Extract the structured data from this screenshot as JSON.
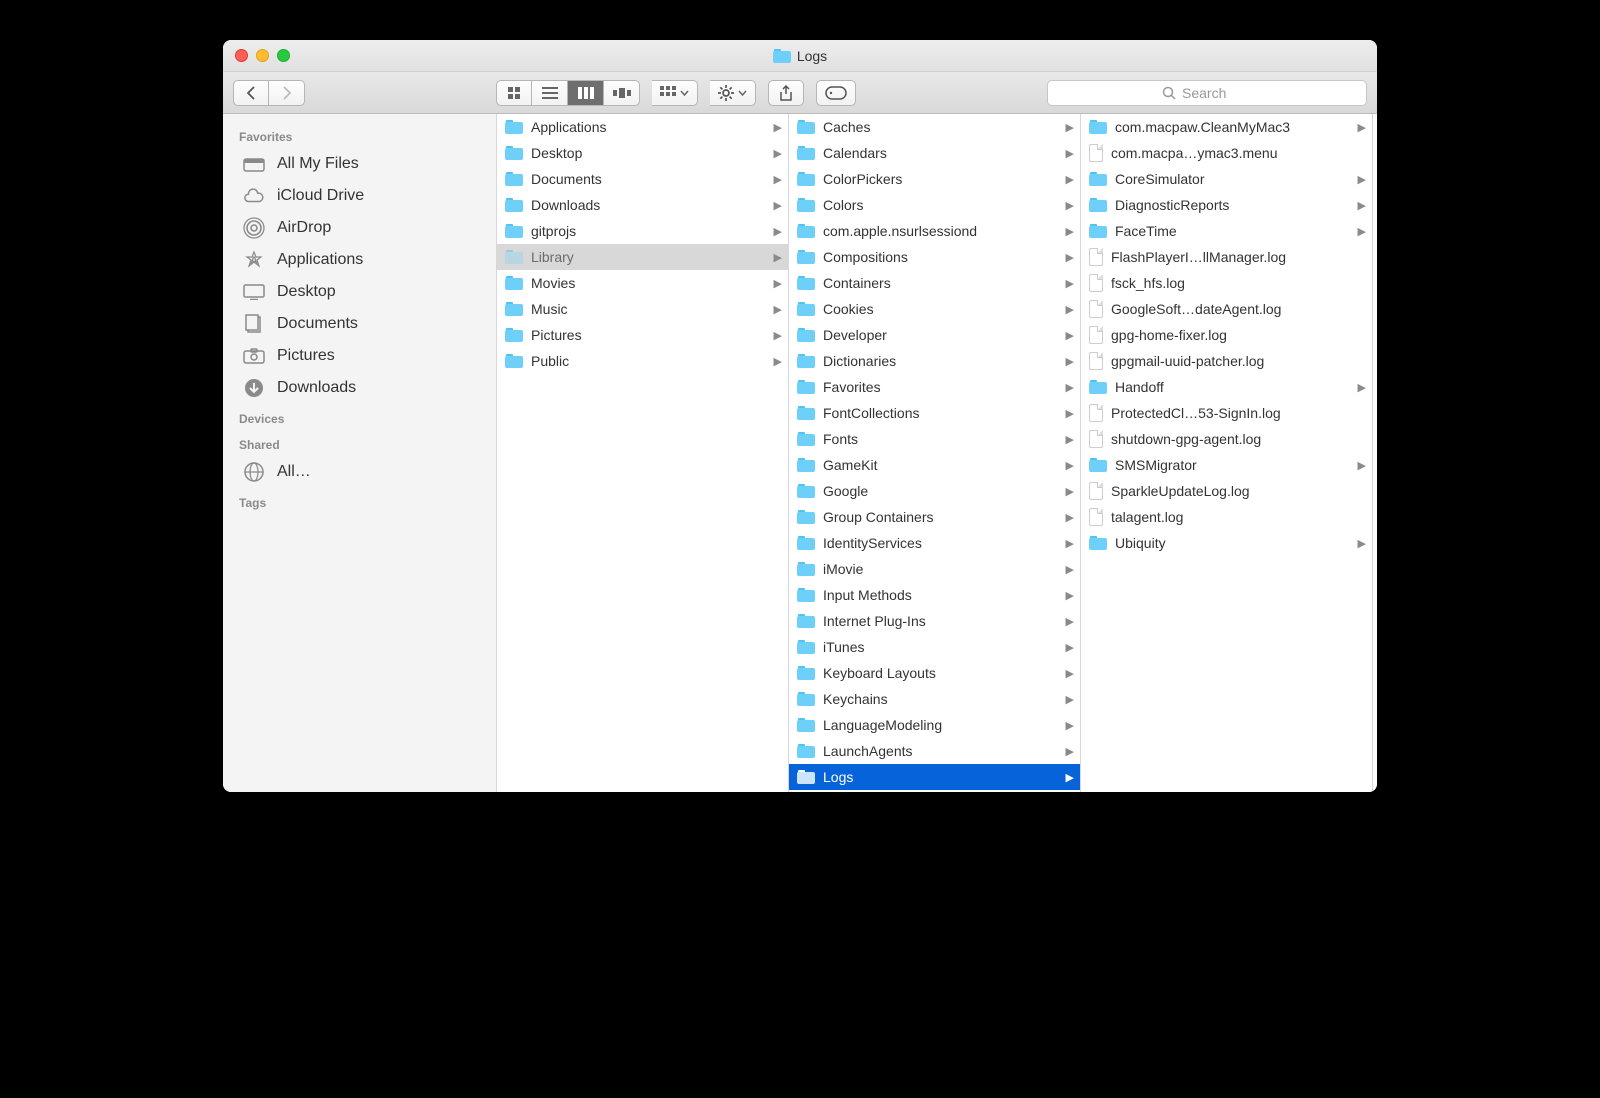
{
  "window": {
    "title": "Logs"
  },
  "toolbar": {
    "search_placeholder": "Search"
  },
  "sidebar": {
    "sections": [
      {
        "heading": "Favorites",
        "items": [
          {
            "icon": "all-my-files",
            "label": "All My Files"
          },
          {
            "icon": "icloud",
            "label": "iCloud Drive"
          },
          {
            "icon": "airdrop",
            "label": "AirDrop"
          },
          {
            "icon": "applications",
            "label": "Applications"
          },
          {
            "icon": "desktop",
            "label": "Desktop"
          },
          {
            "icon": "documents",
            "label": "Documents"
          },
          {
            "icon": "pictures",
            "label": "Pictures"
          },
          {
            "icon": "downloads",
            "label": "Downloads"
          }
        ]
      },
      {
        "heading": "Devices",
        "items": []
      },
      {
        "heading": "Shared",
        "items": [
          {
            "icon": "network",
            "label": "All…"
          }
        ]
      },
      {
        "heading": "Tags",
        "items": []
      }
    ]
  },
  "columns": [
    {
      "items": [
        {
          "type": "folder",
          "label": "Applications",
          "hasChildren": true
        },
        {
          "type": "folder",
          "label": "Desktop",
          "hasChildren": true
        },
        {
          "type": "folder",
          "label": "Documents",
          "hasChildren": true
        },
        {
          "type": "folder",
          "label": "Downloads",
          "hasChildren": true
        },
        {
          "type": "folder",
          "label": "gitprojs",
          "hasChildren": true
        },
        {
          "type": "folder",
          "label": "Library",
          "hasChildren": true,
          "selected": "grey"
        },
        {
          "type": "folder",
          "label": "Movies",
          "hasChildren": true
        },
        {
          "type": "folder",
          "label": "Music",
          "hasChildren": true
        },
        {
          "type": "folder",
          "label": "Pictures",
          "hasChildren": true
        },
        {
          "type": "folder",
          "label": "Public",
          "hasChildren": true
        }
      ]
    },
    {
      "items": [
        {
          "type": "folder",
          "label": "Caches",
          "hasChildren": true
        },
        {
          "type": "folder",
          "label": "Calendars",
          "hasChildren": true
        },
        {
          "type": "folder",
          "label": "ColorPickers",
          "hasChildren": true
        },
        {
          "type": "folder",
          "label": "Colors",
          "hasChildren": true
        },
        {
          "type": "folder",
          "label": "com.apple.nsurlsessiond",
          "hasChildren": true
        },
        {
          "type": "folder",
          "label": "Compositions",
          "hasChildren": true
        },
        {
          "type": "folder",
          "label": "Containers",
          "hasChildren": true
        },
        {
          "type": "folder",
          "label": "Cookies",
          "hasChildren": true
        },
        {
          "type": "folder",
          "label": "Developer",
          "hasChildren": true
        },
        {
          "type": "folder",
          "label": "Dictionaries",
          "hasChildren": true
        },
        {
          "type": "folder",
          "label": "Favorites",
          "hasChildren": true
        },
        {
          "type": "folder",
          "label": "FontCollections",
          "hasChildren": true
        },
        {
          "type": "folder",
          "label": "Fonts",
          "hasChildren": true
        },
        {
          "type": "folder",
          "label": "GameKit",
          "hasChildren": true
        },
        {
          "type": "folder",
          "label": "Google",
          "hasChildren": true
        },
        {
          "type": "folder",
          "label": "Group Containers",
          "hasChildren": true
        },
        {
          "type": "folder",
          "label": "IdentityServices",
          "hasChildren": true
        },
        {
          "type": "folder",
          "label": "iMovie",
          "hasChildren": true
        },
        {
          "type": "folder",
          "label": "Input Methods",
          "hasChildren": true
        },
        {
          "type": "folder",
          "label": "Internet Plug-Ins",
          "hasChildren": true
        },
        {
          "type": "folder",
          "label": "iTunes",
          "hasChildren": true
        },
        {
          "type": "folder",
          "label": "Keyboard Layouts",
          "hasChildren": true
        },
        {
          "type": "folder",
          "label": "Keychains",
          "hasChildren": true
        },
        {
          "type": "folder",
          "label": "LanguageModeling",
          "hasChildren": true
        },
        {
          "type": "folder",
          "label": "LaunchAgents",
          "hasChildren": true
        },
        {
          "type": "folder",
          "label": "Logs",
          "hasChildren": true,
          "selected": "blue"
        }
      ]
    },
    {
      "items": [
        {
          "type": "folder",
          "label": "com.macpaw.CleanMyMac3",
          "hasChildren": true
        },
        {
          "type": "file",
          "label": "com.macpa…ymac3.menu"
        },
        {
          "type": "folder",
          "label": "CoreSimulator",
          "hasChildren": true
        },
        {
          "type": "folder",
          "label": "DiagnosticReports",
          "hasChildren": true
        },
        {
          "type": "folder",
          "label": "FaceTime",
          "hasChildren": true
        },
        {
          "type": "file",
          "label": "FlashPlayerI…llManager.log"
        },
        {
          "type": "file",
          "label": "fsck_hfs.log"
        },
        {
          "type": "file",
          "label": "GoogleSoft…dateAgent.log"
        },
        {
          "type": "file",
          "label": "gpg-home-fixer.log"
        },
        {
          "type": "file",
          "label": "gpgmail-uuid-patcher.log"
        },
        {
          "type": "folder",
          "label": "Handoff",
          "hasChildren": true
        },
        {
          "type": "file",
          "label": "ProtectedCl…53-SignIn.log"
        },
        {
          "type": "file",
          "label": "shutdown-gpg-agent.log"
        },
        {
          "type": "folder",
          "label": "SMSMigrator",
          "hasChildren": true
        },
        {
          "type": "file",
          "label": "SparkleUpdateLog.log"
        },
        {
          "type": "file",
          "label": "talagent.log"
        },
        {
          "type": "folder",
          "label": "Ubiquity",
          "hasChildren": true
        }
      ]
    }
  ]
}
